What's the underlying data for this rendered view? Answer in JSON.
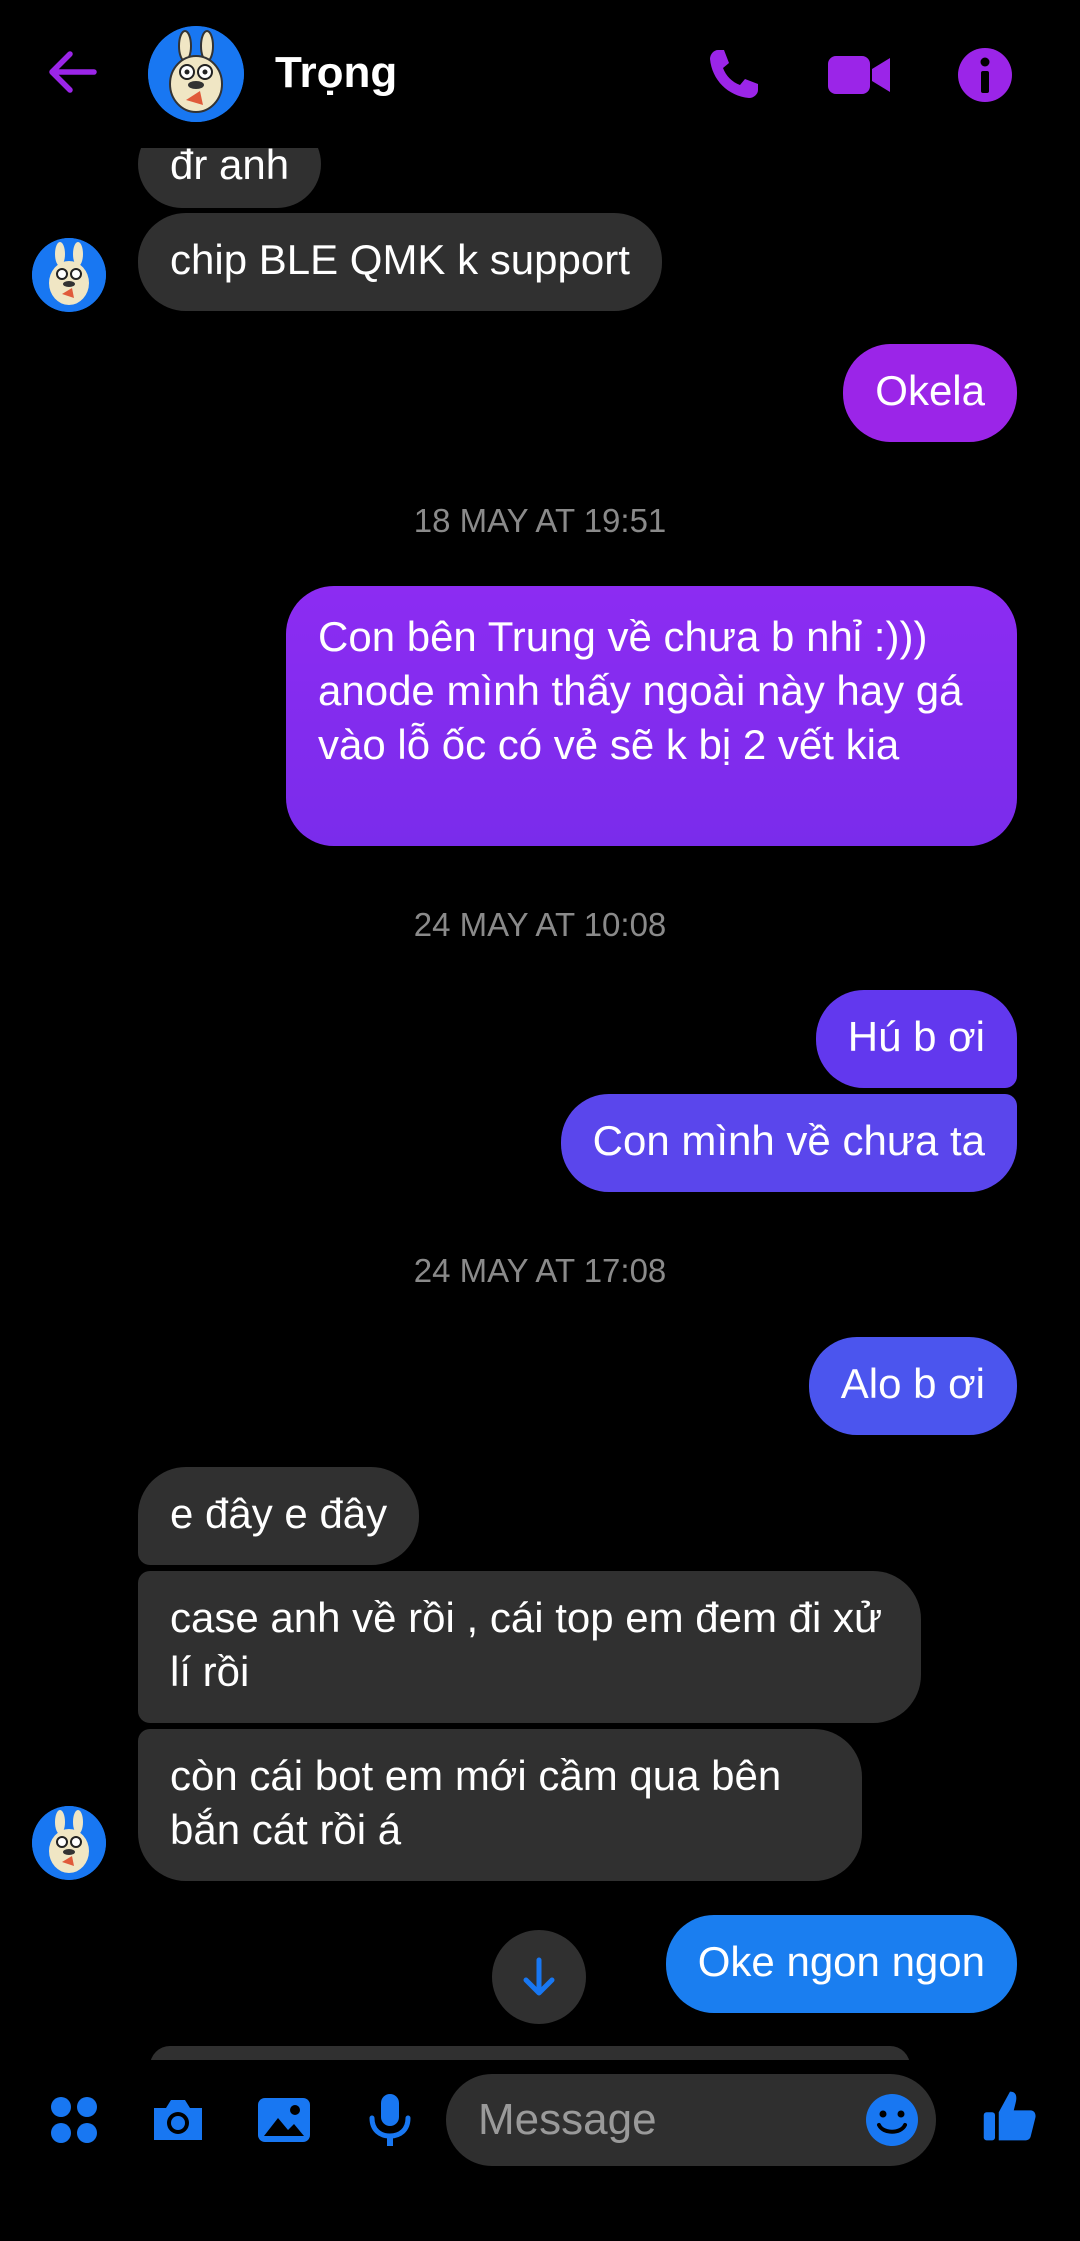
{
  "header": {
    "contact_name": "Trọng"
  },
  "messages": [
    {
      "text": "đr anh"
    },
    {
      "text": "chip BLE QMK k support"
    },
    {
      "text": "Okela"
    },
    {
      "text": "Con bên Trung về chưa b nhỉ :))) anode mình thấy ngoài này hay gá vào lỗ ốc có vẻ sẽ k bị 2 vết kia"
    },
    {
      "text": "Hú b ơi"
    },
    {
      "text": "Con mình về chưa ta"
    },
    {
      "text": "Alo b ơi"
    },
    {
      "text": "e đây e đây"
    },
    {
      "text": "case anh về rồi , cái top em đem đi xử lí rồi"
    },
    {
      "text": "còn cái bot em mới cầm qua bên bắn cát rồi á"
    },
    {
      "text": "Oke ngon ngon"
    }
  ],
  "timestamps": [
    "18 MAY AT 19:51",
    "24 MAY AT 10:08",
    "24 MAY AT 17:08"
  ],
  "composer": {
    "placeholder": "Message"
  },
  "colors": {
    "accent_purple": "#9b25e8",
    "bubble_purple": "#7c2df0",
    "bubble_indigo": "#5a46ec",
    "bubble_blue": "#1a7ef0",
    "incoming": "#303030",
    "icon_blue": "#1877f2"
  },
  "icons": {
    "back": "arrow-left-icon",
    "call": "phone-icon",
    "video": "video-camera-icon",
    "info": "info-icon",
    "apps": "apps-grid-icon",
    "camera": "camera-icon",
    "gallery": "image-icon",
    "mic": "microphone-icon",
    "emoji": "emoji-icon",
    "like": "thumbs-up-icon",
    "scroll": "arrow-down-icon"
  }
}
